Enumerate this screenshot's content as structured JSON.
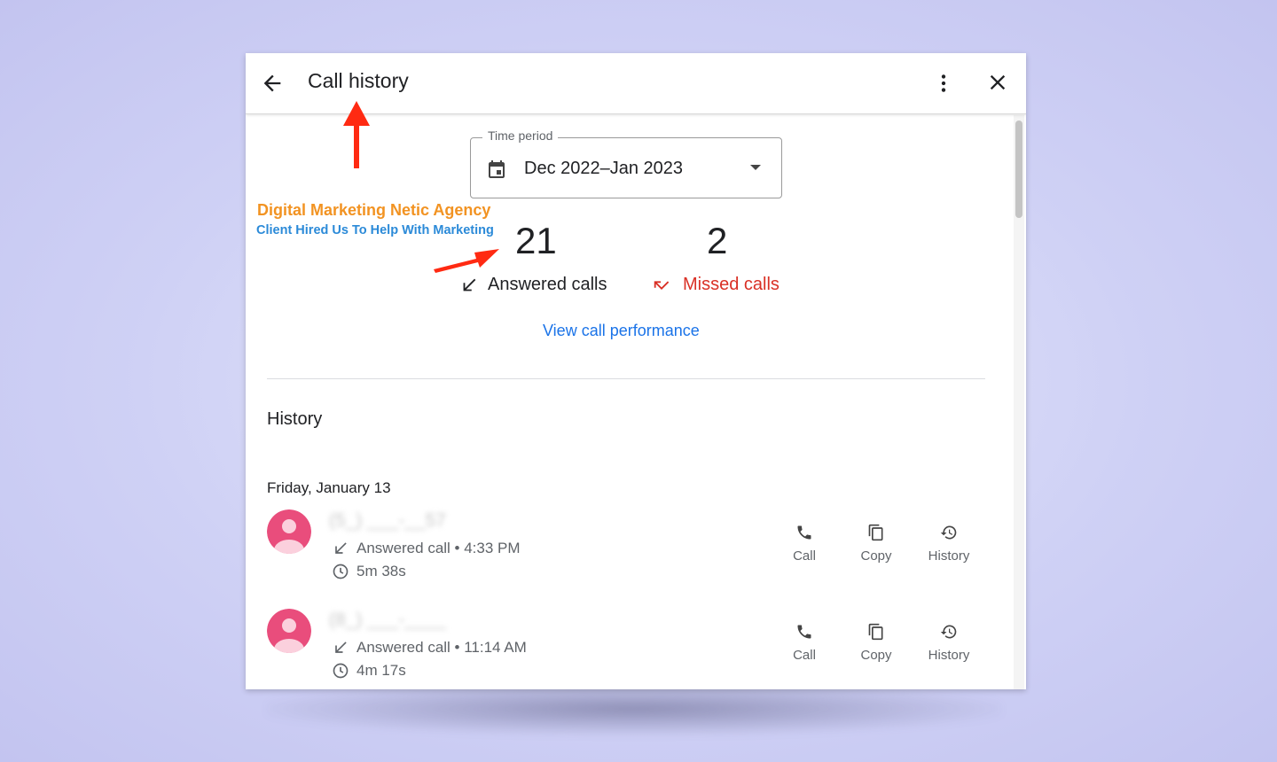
{
  "window": {
    "title": "Call history"
  },
  "time_period": {
    "label": "Time period",
    "value": "Dec 2022–Jan 2023"
  },
  "promo": {
    "line1": "Digital Marketing Netic Agency",
    "line2": "Client Hired Us To Help With Marketing"
  },
  "stats": {
    "answered_count": "21",
    "answered_label": "Answered calls",
    "missed_count": "2",
    "missed_label": "Missed calls",
    "missed_color": "#d93025"
  },
  "performance_link": "View call performance",
  "history": {
    "heading": "History",
    "date": "Friday, January 13",
    "calls": [
      {
        "number": "(5_) ___-__57",
        "status": "Answered call • 4:33 PM",
        "duration": "5m 38s",
        "actions": [
          "Call",
          "Copy",
          "History"
        ]
      },
      {
        "number": "(8_) ___-____",
        "status": "Answered call • 11:14 AM",
        "duration": "4m 17s",
        "actions": [
          "Call",
          "Copy",
          "History"
        ]
      }
    ]
  },
  "colors": {
    "accent": "#1a73e8",
    "avatar": "#e94d7c",
    "annotation_arrow": "#ff2a12",
    "promo_orange": "#f29322",
    "promo_blue": "#2b8ad8"
  }
}
